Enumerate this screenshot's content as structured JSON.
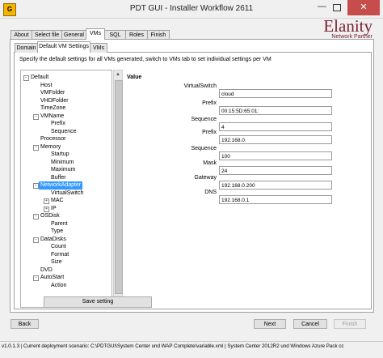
{
  "window": {
    "app_icon": "G",
    "title": "PDT GUI -  Installer Workflow 2611",
    "close_glyph": "✕",
    "minimize_glyph": "—"
  },
  "logo": {
    "name": "Elanity",
    "tagline": "Network Partner"
  },
  "main_tabs": [
    {
      "label": "About",
      "active": false
    },
    {
      "label": "Select file",
      "active": false
    },
    {
      "label": "General",
      "active": false
    },
    {
      "label": "VMs",
      "active": true
    },
    {
      "label": "SQL",
      "active": false
    },
    {
      "label": "Roles",
      "active": false
    },
    {
      "label": "Finish",
      "active": false
    }
  ],
  "sub_tabs": [
    {
      "label": "Domain",
      "active": false
    },
    {
      "label": "Default VM Settings",
      "active": true
    },
    {
      "label": "VMs",
      "active": false
    }
  ],
  "instructions": "Specify the default settings for all VMs generated, switch to VMs tab to set individual settings per VM",
  "tree": {
    "items": [
      {
        "label": "Default",
        "level": 0,
        "expander": "−"
      },
      {
        "label": "Host",
        "level": 1
      },
      {
        "label": "VMFolder",
        "level": 1
      },
      {
        "label": "VHDFolder",
        "level": 1
      },
      {
        "label": "TimeZone",
        "level": 1
      },
      {
        "label": "VMName",
        "level": 1,
        "expander": "−"
      },
      {
        "label": "Prefix",
        "level": 2
      },
      {
        "label": "Sequence",
        "level": 2
      },
      {
        "label": "Processor",
        "level": 1
      },
      {
        "label": "Memory",
        "level": 1,
        "expander": "−"
      },
      {
        "label": "Startup",
        "level": 2
      },
      {
        "label": "Minimum",
        "level": 2
      },
      {
        "label": "Maximum",
        "level": 2
      },
      {
        "label": "Buffer",
        "level": 2
      },
      {
        "label": "NetworkAdapter",
        "level": 1,
        "expander": "−",
        "selected": true
      },
      {
        "label": "VirtualSwitch",
        "level": 2
      },
      {
        "label": "MAC",
        "level": 2,
        "expander": "+"
      },
      {
        "label": "IP",
        "level": 2,
        "expander": "+"
      },
      {
        "label": "OSDisk",
        "level": 1,
        "expander": "−"
      },
      {
        "label": "Parent",
        "level": 2
      },
      {
        "label": "Type",
        "level": 2
      },
      {
        "label": "DataDisks",
        "level": 1,
        "expander": "−"
      },
      {
        "label": "Count",
        "level": 2
      },
      {
        "label": "Format",
        "level": 2
      },
      {
        "label": "Size",
        "level": 2
      },
      {
        "label": "DVD",
        "level": 1
      },
      {
        "label": "AutoStart",
        "level": 1,
        "expander": "−"
      },
      {
        "label": "Action",
        "level": 2
      }
    ],
    "save_label": "Save setting",
    "scroll_up_glyph": "▲",
    "scroll_down_glyph": "▼"
  },
  "value_panel": {
    "header": "Value",
    "fields": [
      {
        "label": "VirtualSwitch",
        "value": "cloud"
      },
      {
        "label": "Prefix",
        "value": "00:15:5D:65:01:"
      },
      {
        "label": "Sequence",
        "value": "4"
      },
      {
        "label": "Prefix",
        "value": "192.168.0."
      },
      {
        "label": "Sequence",
        "value": "100"
      },
      {
        "label": "Mask",
        "value": "24"
      },
      {
        "label": "Gateway",
        "value": "192.168.0.200"
      },
      {
        "label": "DNS",
        "value": "192.168.0.1"
      }
    ]
  },
  "footer": {
    "back_label": "Back",
    "next_label": "Next",
    "cancel_label": "Cancel",
    "finish_label": "Finish"
  },
  "status": "v1.0.1.3 | Current deployment scenario: C:\\PDTGUI\\System Center und WAP Complete\\variable.xml | System Center 2012R2 und Windows Azure Pack cc"
}
